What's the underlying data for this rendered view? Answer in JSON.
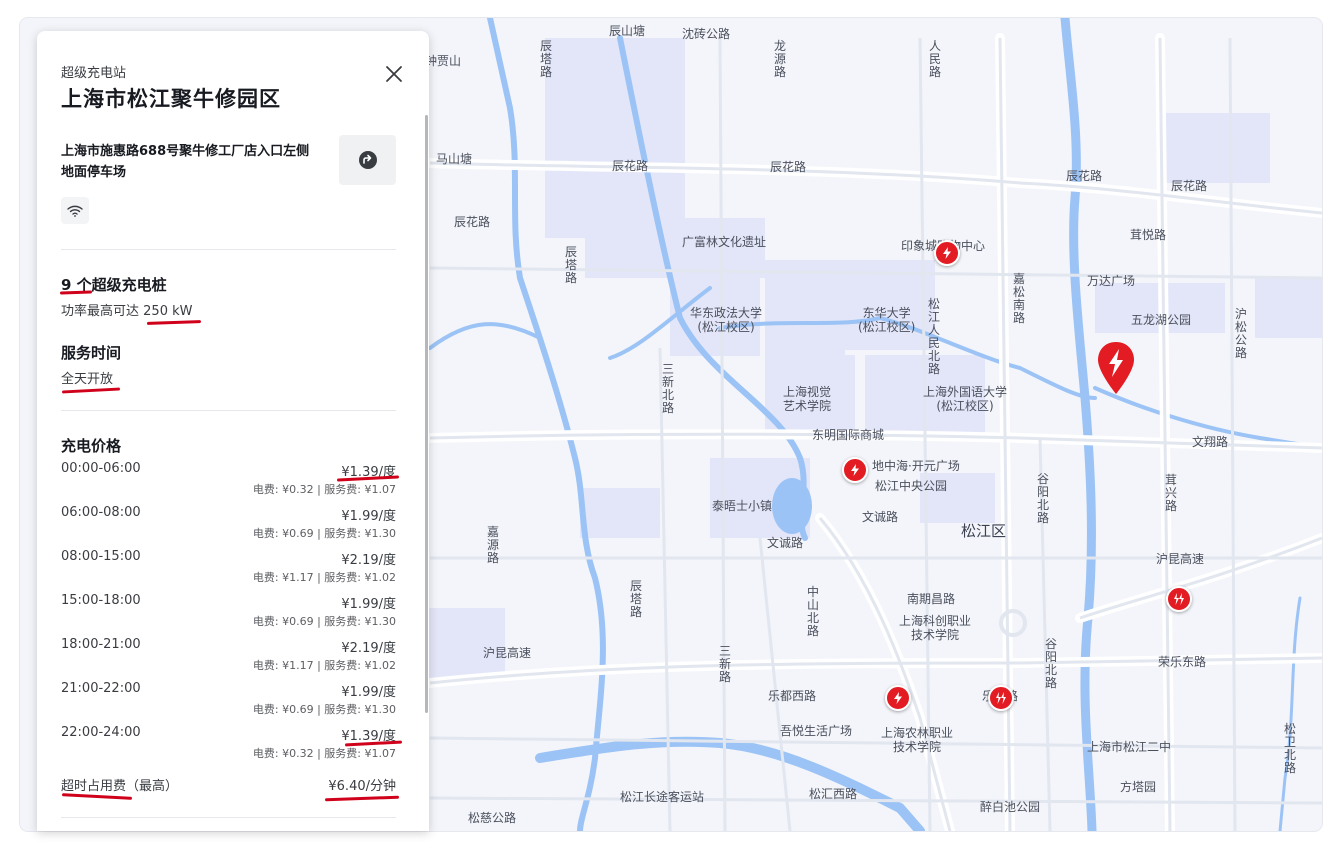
{
  "panel": {
    "subtitle": "超级充电站",
    "title": "上海市松江聚牛修园区",
    "address": "上海市施惠路688号聚牛修工厂店入口左侧地面停车场",
    "stalls_count": "9 个",
    "stalls_label": "超级充电桩",
    "power_prefix": "功率最高可达",
    "power_value": "250 kW",
    "hours_title": "服务时间",
    "hours_value": "全天开放",
    "pricing_title": "充电价格",
    "prices": [
      {
        "time": "00:00-06:00",
        "price": "¥1.39/度",
        "detail": "电费: ¥0.32 | 服务费: ¥1.07"
      },
      {
        "time": "06:00-08:00",
        "price": "¥1.99/度",
        "detail": "电费: ¥0.69 | 服务费: ¥1.30"
      },
      {
        "time": "08:00-15:00",
        "price": "¥2.19/度",
        "detail": "电费: ¥1.17 | 服务费: ¥1.02"
      },
      {
        "time": "15:00-18:00",
        "price": "¥1.99/度",
        "detail": "电费: ¥0.69 | 服务费: ¥1.30"
      },
      {
        "time": "18:00-21:00",
        "price": "¥2.19/度",
        "detail": "电费: ¥1.17 | 服务费: ¥1.02"
      },
      {
        "time": "21:00-22:00",
        "price": "¥1.99/度",
        "detail": "电费: ¥0.69 | 服务费: ¥1.30"
      },
      {
        "time": "22:00-24:00",
        "price": "¥1.39/度",
        "detail": "电费: ¥0.32 | 服务费: ¥1.07"
      }
    ],
    "idle_label": "超时占用费",
    "idle_note": "（最高）",
    "idle_value": "¥6.40/分钟"
  },
  "map": {
    "labels": {
      "chenshan": "辰山塘",
      "shenzhuan": "沈砖公路",
      "chenta1": "辰塔路",
      "longyuan": "龙源路",
      "renmin": "人民路",
      "shenguan": "钟贾山",
      "mashan": "马山塘",
      "chenhua1": "辰花路",
      "chenhua2": "辰花路",
      "chenhua3": "辰花路",
      "chenhua4": "辰花路",
      "chenhua5": "辰花路",
      "guangfulin": "广富林文化遗址",
      "chenta2": "辰塔路",
      "yinxiang": "印象城购物中心",
      "jiasong": "嘉松南路",
      "wanda": "万达广场",
      "qianyue": "茸悦路",
      "wulonghu": "五龙湖公园",
      "husong": "沪松公路",
      "huadong": "华东政法大学\n(松江校区)",
      "donghua": "东华大学\n(松江校区)",
      "songjiangrenmin": "松江人民北路",
      "sanxin1": "三新北路",
      "shijue": "上海视觉\n艺术学院",
      "waiguoyu": "上海外国语大学\n(松江校区)",
      "dongming": "东明国际商城",
      "wenxiang": "文翔路",
      "dizhonghai": "地中海·开元广场",
      "songjiangpark": "松江中央公园",
      "guyang1": "谷阳北路",
      "taiwushi": "泰晤士小镇",
      "wencheng1": "文诚路",
      "wencheng2": "文诚路",
      "songjiangqu": "松江区",
      "rongxing": "茸兴路",
      "hukun1": "沪昆高速",
      "huyuan": "嘉源路",
      "chenta3": "辰塔路",
      "chenshan2": "中山北路",
      "nanqi": "南期昌路",
      "kechuang": "上海科创职业\n技术学院",
      "hukun2": "沪昆高速",
      "guyang2": "谷阳北路",
      "rongle": "荣乐东路",
      "sanxin2": "三新路",
      "ledu": "乐都西路",
      "ledu2": "乐都路",
      "wuyue": "吾悦生活广场",
      "nonglin": "上海农林职业\n技术学院",
      "songjiang2": "上海市松江二中",
      "songwei": "松卫北路",
      "fangta": "方塔园",
      "changtu": "松江长途客运站",
      "songhui": "松汇西路",
      "zuibai": "醉白池公园",
      "songci": "松慈公路"
    }
  },
  "colors": {
    "accent": "#e31b23",
    "water": "#9cc3f5",
    "campus": "#e3e6f8",
    "underline": "#d0021b"
  }
}
